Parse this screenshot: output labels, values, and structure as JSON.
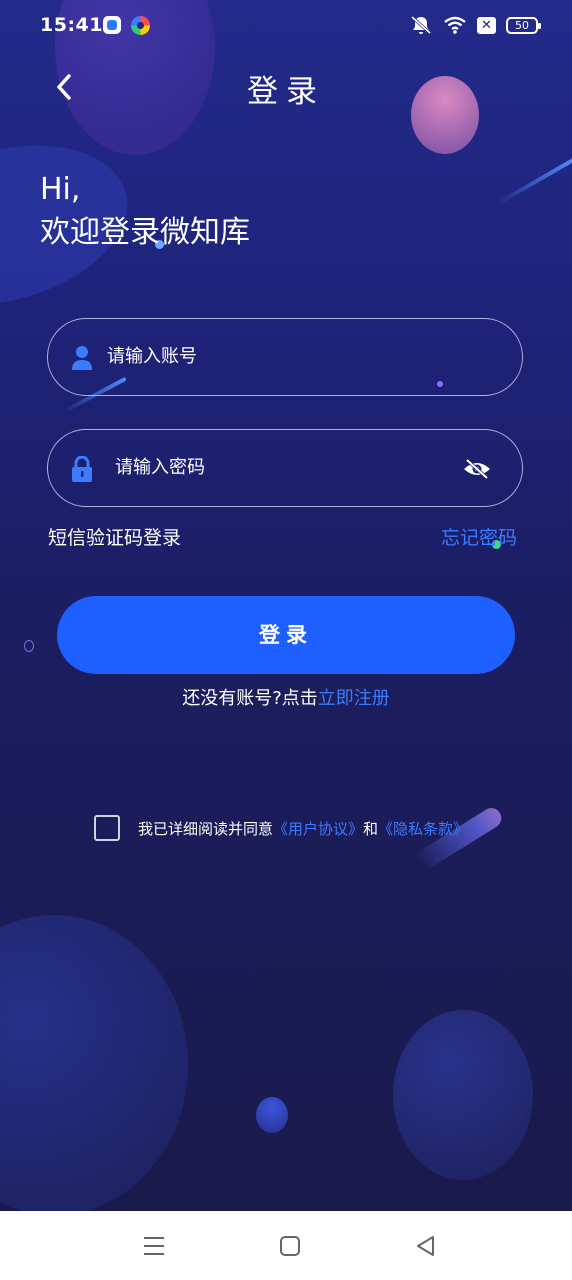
{
  "status_bar": {
    "time": "15:41",
    "battery": "50",
    "icons": [
      "app-notification-icon",
      "colorful-app-icon",
      "mute-icon",
      "wifi-icon",
      "no-sim-icon",
      "battery-icon"
    ]
  },
  "header": {
    "title": "登录",
    "back_icon": "chevron-left-icon"
  },
  "greeting": {
    "line1": "Hi,",
    "line2": "欢迎登录微知库"
  },
  "form": {
    "account_placeholder": "请输入账号",
    "password_placeholder": "请输入密码",
    "sms_login": "短信验证码登录",
    "forgot_password": "忘记密码",
    "login_button": "登录"
  },
  "register": {
    "prompt": "还没有账号?点击",
    "link": "立即注册"
  },
  "agreement": {
    "checked": false,
    "prefix": "我已详细阅读并同意",
    "user_agreement": "《用户协议》",
    "conjunction": "和",
    "privacy_policy": "《隐私条款》"
  },
  "nav_bar": {
    "buttons": [
      "menu-icon",
      "home-icon",
      "back-triangle-icon"
    ]
  },
  "colors": {
    "background_top": "#232a8a",
    "background_bottom": "#1a1a4c",
    "accent": "#1e5fff",
    "link": "#3b7cff"
  }
}
